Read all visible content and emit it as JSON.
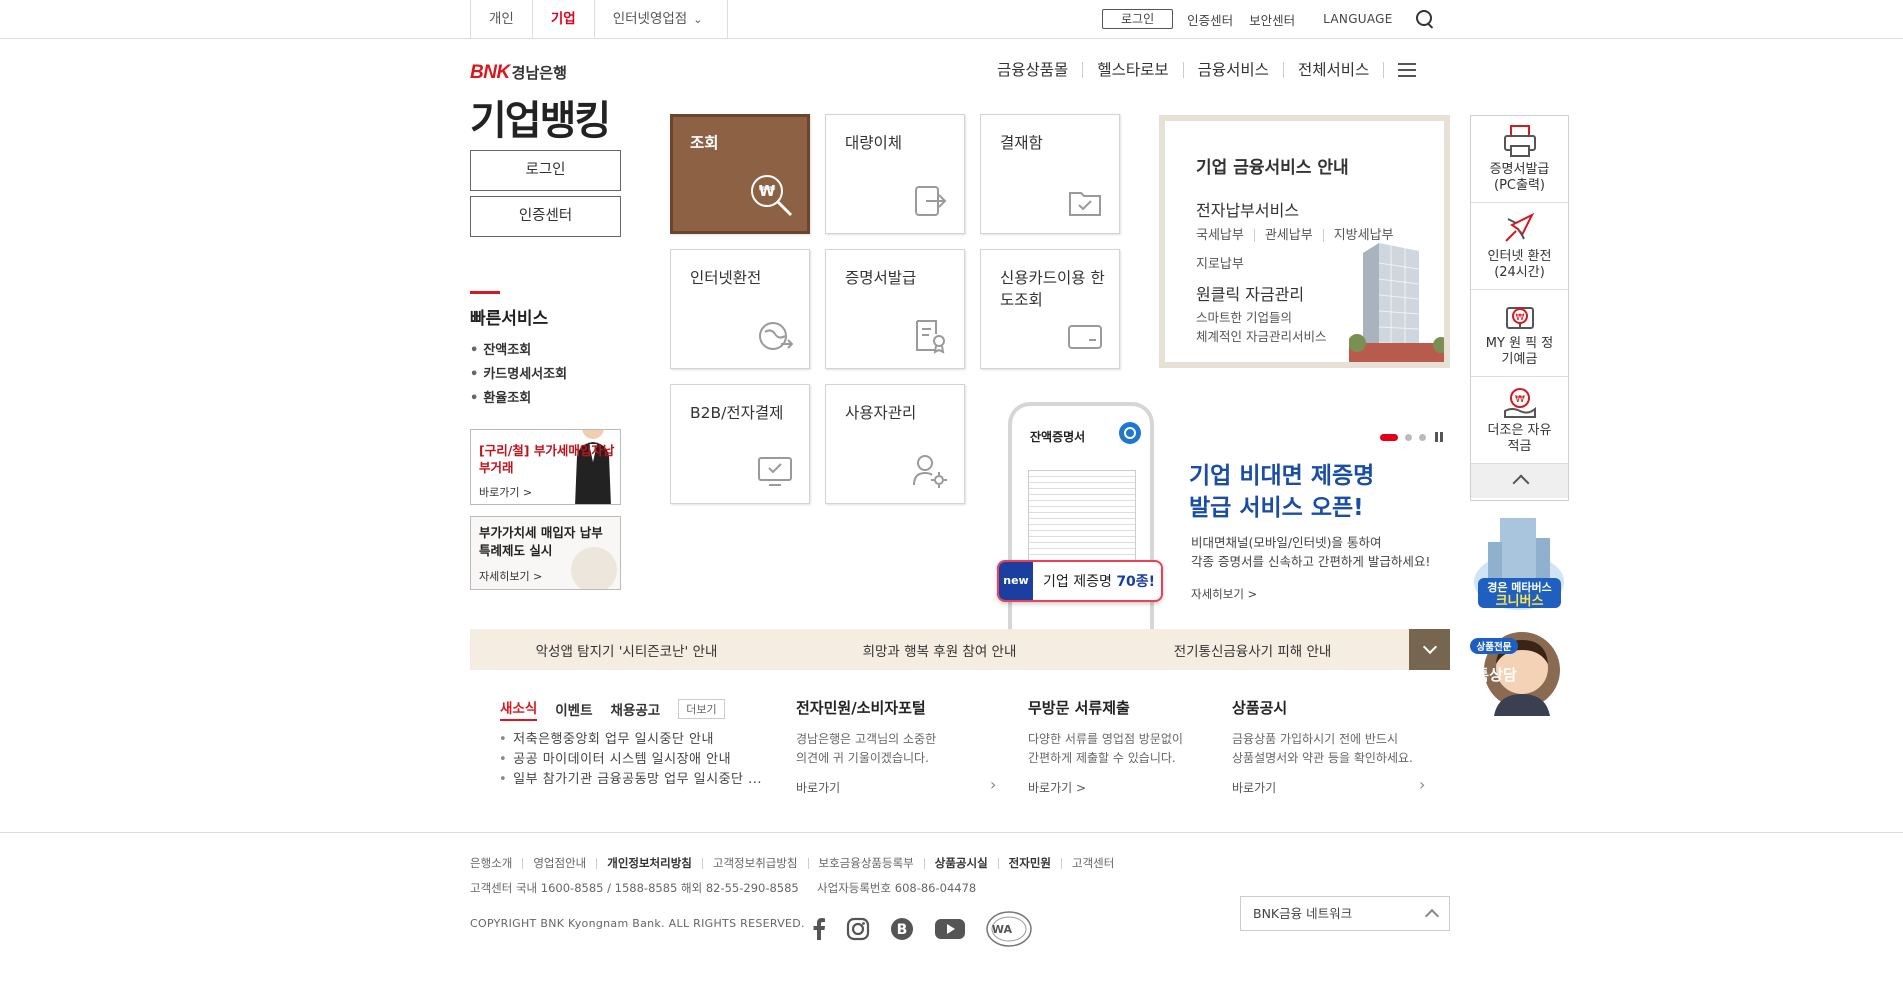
{
  "topbar": {
    "tabs": [
      "개인",
      "기업",
      "인터넷영업점"
    ],
    "login": "로그인",
    "cert_center": "인증센터",
    "security_center": "보안센터",
    "language": "LANGUAGE"
  },
  "logo": {
    "brand": "BNK",
    "bank": "경남은행",
    "title": "기업뱅킹"
  },
  "gnb": [
    "금융상품몰",
    "헬스타로보",
    "금융서비스",
    "전체서비스"
  ],
  "side": {
    "login": "로그인",
    "cert": "인증센터",
    "quick_title": "빠른서비스",
    "quick_items": [
      "잔액조회",
      "카드명세서조회",
      "환율조회"
    ],
    "banner1_title": "[구리/철] 부가세매입자납부거래",
    "banner1_more": "바로가기 >",
    "banner2_title": "부가가치세 매입자 납부 특례제도 실시",
    "banner2_more": "자세히보기 >"
  },
  "tiles": [
    {
      "label": "조회",
      "icon": "search-won-icon"
    },
    {
      "label": "대량이체",
      "icon": "transfer-icon"
    },
    {
      "label": "결재함",
      "icon": "approval-box-icon"
    },
    {
      "label": "인터넷환전",
      "icon": "exchange-icon"
    },
    {
      "label": "증명서발급",
      "icon": "certificate-icon"
    },
    {
      "label": "신용카드이용 한도조회",
      "icon": "credit-card-icon"
    },
    {
      "label": "B2B/전자결제",
      "icon": "monitor-check-icon"
    },
    {
      "label": "사용자관리",
      "icon": "user-settings-icon"
    }
  ],
  "service": {
    "heading": "기업 금융서비스 안내",
    "sub1": "전자납부서비스",
    "links": [
      "국세납부",
      "관세납부",
      "지방세납부"
    ],
    "link4": "지로납부",
    "sub2": "원클릭 자금관리",
    "sub2_desc1": "스마트한 기업들의",
    "sub2_desc2": "체계적인 자금관리서비스"
  },
  "promo": {
    "phone_title": "잔액증명서",
    "badge_new": "new",
    "badge_text": "기업 제증명",
    "badge_count": "70종!",
    "title1": "기업 비대면 제증명",
    "title2": "발급 서비스 오픈!",
    "desc1": "비대면채널(모바일/인터넷)을 통하여",
    "desc2": "각종 증명서를 신속하고 간편하게 발급하세요!",
    "more": "자세히보기 >"
  },
  "quickbar": [
    {
      "label": "증명서발급 (PC출력)",
      "icon": "printer-icon"
    },
    {
      "label": "인터넷 환전 (24시간)",
      "icon": "airplane-icon"
    },
    {
      "label": "MY 원 픽 정기예금",
      "icon": "gift-won-icon"
    },
    {
      "label": "더조은 자유적금",
      "icon": "hand-won-icon"
    }
  ],
  "meta_label": "경은 메타버스 크니버스",
  "talk_label": "상품전문 톡상담",
  "strip": [
    "악성앱 탐지기 '시티즌코난' 안내",
    "희망과 행복 후원 참여 안내",
    "전기통신금융사기 피해 안내"
  ],
  "news": {
    "tabs": [
      "새소식",
      "이벤트",
      "채용공고"
    ],
    "more": "더보기",
    "items": [
      "저축은행중앙회 업무 일시중단 안내",
      "공공 마이데이터 시스템 일시장애 안내",
      "일부 참가기관 금융공동망 업무 일시중단 ..."
    ]
  },
  "info": [
    {
      "title": "전자민원/소비자포털",
      "desc1": "경남은행은 고객님의 소중한",
      "desc2": "의견에 귀 기울이겠습니다.",
      "go": "바로가기"
    },
    {
      "title": "무방문 서류제출",
      "desc1": "다양한 서류를 영업점 방문없이",
      "desc2": "간편하게 제출할 수 있습니다.",
      "go": "바로가기 >"
    },
    {
      "title": "상품공시",
      "desc1": "금융상품 가입하시기 전에 반드시",
      "desc2": "상품설명서와 약관 등을 확인하세요.",
      "go": "바로가기"
    }
  ],
  "footer": {
    "links": [
      "은행소개",
      "영업점안내",
      "개인정보처리방침",
      "고객정보취급방침",
      "보호금융상품등록부",
      "상품공시실",
      "전자민원",
      "고객센터"
    ],
    "contact": "고객센터 국내 1600-8585 / 1588-8585 해외 82-55-290-8585",
    "bizno": "사업자등록번호 608-86-04478",
    "copyright": "COPYRIGHT BNK Kyongnam Bank. ALL RIGHTS RESERVED.",
    "network": "BNK금융 네트워크"
  }
}
